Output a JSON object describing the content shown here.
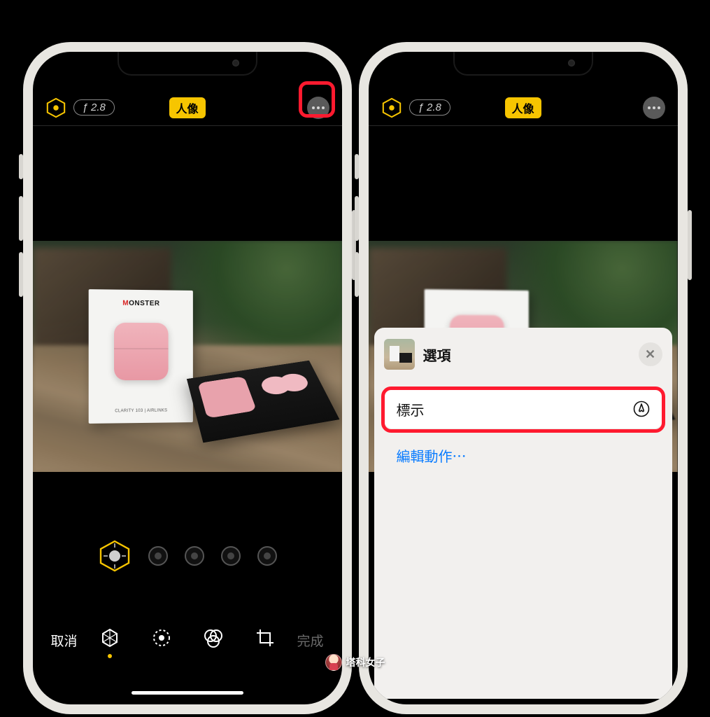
{
  "left": {
    "topbar": {
      "aperture": "ƒ 2.8",
      "mode_badge": "人像"
    },
    "photo_subject": {
      "brand_prefix": "M",
      "brand_rest": "ONSTER",
      "subtitle": "CLARITY 103 | AIRLINKS"
    },
    "footer": {
      "cancel": "取消",
      "done": "完成"
    }
  },
  "right": {
    "topbar": {
      "aperture": "ƒ 2.8",
      "mode_badge": "人像"
    },
    "sheet": {
      "title": "選項",
      "close_glyph": "✕",
      "markup_label": "標示",
      "edit_actions_label": "編輯動作⋯"
    }
  },
  "watermark": {
    "text": "塔科女子"
  },
  "colors": {
    "accent_yellow": "#f7c500",
    "highlight_red": "#ff1a2f",
    "ios_link_blue": "#0a7cff"
  }
}
